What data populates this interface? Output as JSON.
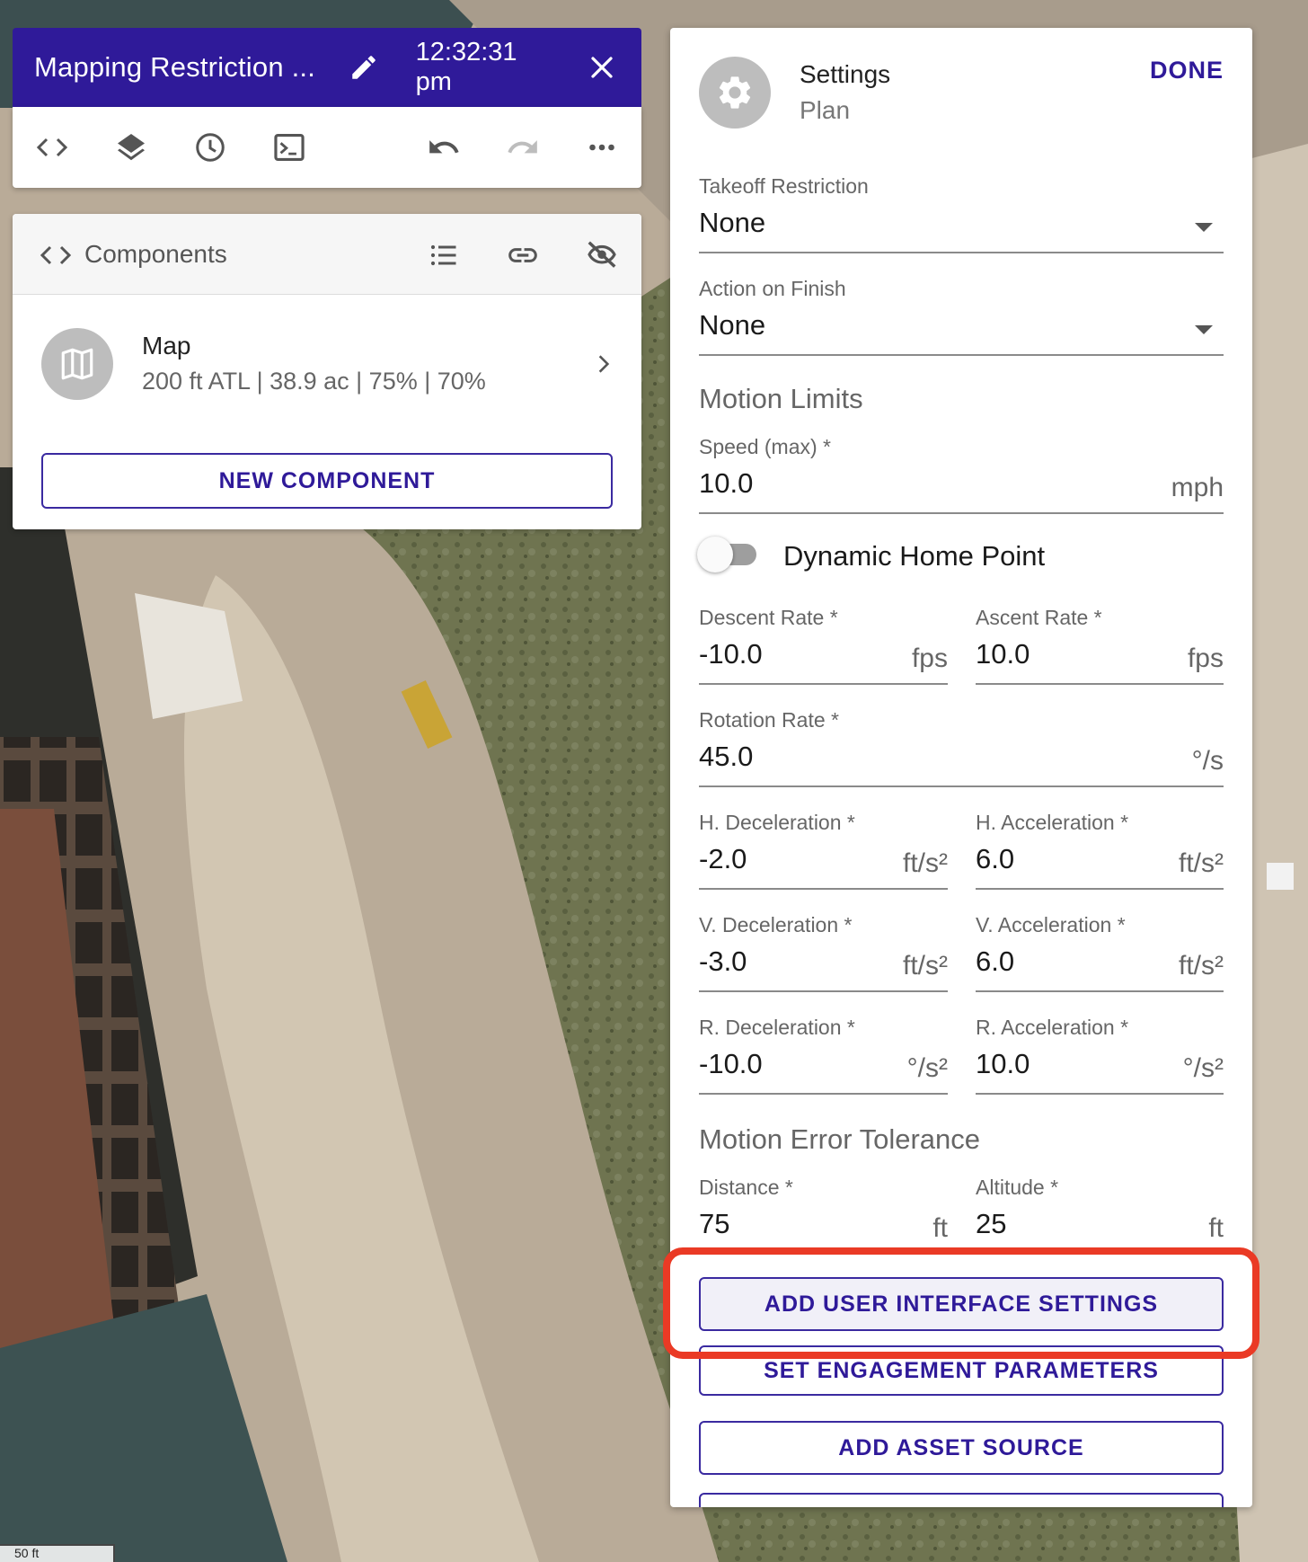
{
  "header": {
    "title": "Mapping Restriction ...",
    "time": "12:32:31 pm"
  },
  "components": {
    "label": "Components",
    "items": [
      {
        "name": "Map",
        "details": "200 ft ATL | 38.9 ac | 75% | 70%"
      }
    ],
    "new_button": "NEW COMPONENT"
  },
  "settings": {
    "title": "Settings",
    "subtitle": "Plan",
    "done_label": "DONE",
    "takeoff": {
      "label": "Takeoff Restriction",
      "value": "None"
    },
    "finish": {
      "label": "Action on Finish",
      "value": "None"
    },
    "motion_limits": "Motion Limits",
    "speed": {
      "label": "Speed (max) *",
      "value": "10.0",
      "unit": "mph"
    },
    "dynamic_home": "Dynamic Home Point",
    "descent": {
      "label": "Descent Rate *",
      "value": "-10.0",
      "unit": "fps"
    },
    "ascent": {
      "label": "Ascent Rate *",
      "value": "10.0",
      "unit": "fps"
    },
    "rotation": {
      "label": "Rotation Rate *",
      "value": "45.0",
      "unit": "°/s"
    },
    "h_decel": {
      "label": "H. Deceleration *",
      "value": "-2.0",
      "unit": "ft/s²"
    },
    "h_accel": {
      "label": "H. Acceleration *",
      "value": "6.0",
      "unit": "ft/s²"
    },
    "v_decel": {
      "label": "V. Deceleration *",
      "value": "-3.0",
      "unit": "ft/s²"
    },
    "v_accel": {
      "label": "V. Acceleration *",
      "value": "6.0",
      "unit": "ft/s²"
    },
    "r_decel": {
      "label": "R. Deceleration *",
      "value": "-10.0",
      "unit": "°/s²"
    },
    "r_accel": {
      "label": "R. Acceleration *",
      "value": "10.0",
      "unit": "°/s²"
    },
    "error_tolerance": "Motion Error Tolerance",
    "distance": {
      "label": "Distance *",
      "value": "75",
      "unit": "ft"
    },
    "altitude": {
      "label": "Altitude *",
      "value": "25",
      "unit": "ft"
    },
    "buttons": {
      "ui_settings": "ADD USER INTERFACE SETTINGS",
      "engagement": "SET ENGAGEMENT PARAMETERS",
      "asset_source": "ADD ASSET SOURCE"
    }
  },
  "map": {
    "scale": "50 ft"
  },
  "colors": {
    "accent": "#2f1a99",
    "highlight": "#ea3a25"
  }
}
